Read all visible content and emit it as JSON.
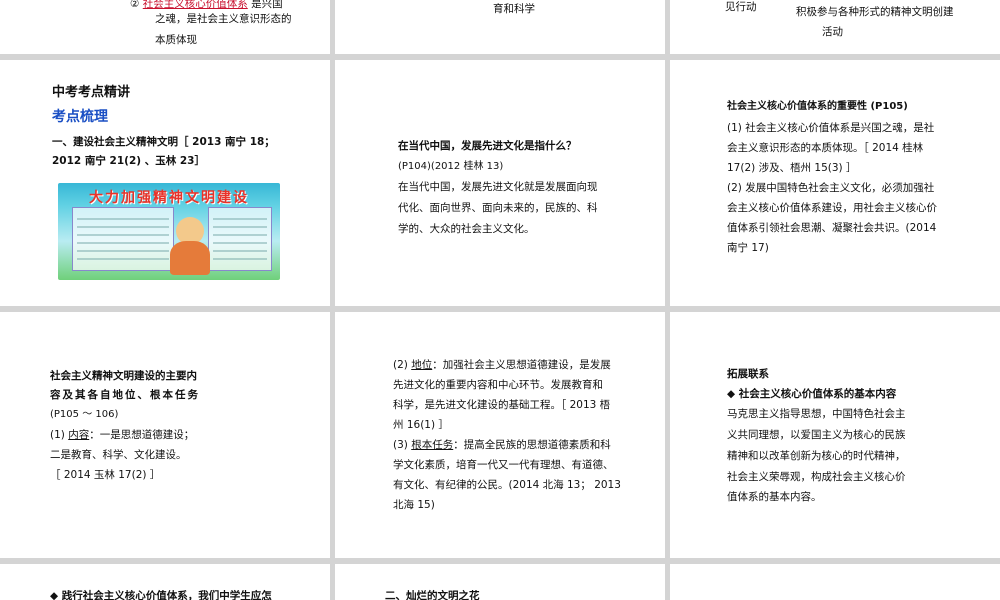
{
  "top": {
    "c1_line1_num": "②",
    "c1_line1_term": "社会主义核心价值体系",
    "c1_line1_tail": "是兴国",
    "c1_line2": "之魂，是社会主义意识形态的",
    "c1_line3": "本质体现",
    "c2_line": "育和科学",
    "c3_line1": "见行动",
    "c3_line2": "积极参与各种形式的精神文明创建",
    "c3_line3": "活动"
  },
  "row1": {
    "left": {
      "heading": "中考考点精讲",
      "subheading": "考点梳理",
      "line1": "一、建设社会主义精神文明［ 2013 南宁 18；",
      "line2": "2012 南宁 21(2) 、玉林 23］",
      "poster_title": "大力加强精神文明建设"
    },
    "mid": {
      "q": "在当代中国，发展先进文化是指什么？",
      "ref": "(P104)(2012 桂林 13)",
      "a1": "在当代中国，发展先进文化就是发展面向现",
      "a2": "代化、面向世界、面向未来的，民族的、科",
      "a3": "学的、大众的社会主义文化。"
    },
    "right": {
      "title": "社会主义核心价值体系的重要性 (P105)",
      "l1": "(1) 社会主义核心价值体系是兴国之魂，是社",
      "l2": "会主义意识形态的本质体现。［ 2014 桂林",
      "l3": "17(2) 涉及、梧州 15(3) ］",
      "l4": "(2) 发展中国特色社会主义文化，必须加强社",
      "l5": "会主义核心价值体系建设，用社会主义核心价",
      "l6": "值体系引领社会思潮、凝聚社会共识。(2014",
      "l7": "南宁 17)"
    }
  },
  "row2": {
    "left": {
      "l1": "社会主义精神文明建设的主要内",
      "l2": "容及其各自地位、根本任务",
      "l3": "(P105 ～ 106)",
      "l4_prefix": "(1) ",
      "l4_term": "内容",
      "l4_tail": "：一是思想道德建设；",
      "l5": "二是教育、科学、文化建设。",
      "l6": "［ 2014 玉林 17(2) ］"
    },
    "mid": {
      "l1_prefix": "(2) ",
      "l1_term": "地位",
      "l1_tail": "：加强社会主义思想道德建设，是发展",
      "l2": "先进文化的重要内容和中心环节。发展教育和",
      "l3": "科学，是先进文化建设的基础工程。［ 2013 梧",
      "l4": "州 16(1) ］",
      "l5_prefix": "(3) ",
      "l5_term": "根本任务",
      "l5_tail": "：提高全民族的思想道德素质和科",
      "l6": "学文化素质，培育一代又一代有理想、有道德、",
      "l7": "有文化、有纪律的公民。(2014 北海 13； 2013",
      "l8": "北海 15)"
    },
    "right": {
      "heading": "拓展联系",
      "sub": "◆ 社会主义核心价值体系的基本内容",
      "l1": "马克思主义指导思想，中国特色社会主",
      "l2": "义共同理想，以爱国主义为核心的民族",
      "l3": "精神和以改革创新为核心的时代精神，",
      "l4": "社会主义荣辱观，构成社会主义核心价",
      "l5": "值体系的基本内容。"
    }
  },
  "bottom": {
    "left": "◆ 践行社会主义核心价值体系，我们中学生应怎",
    "mid": "二、灿烂的文明之花"
  }
}
